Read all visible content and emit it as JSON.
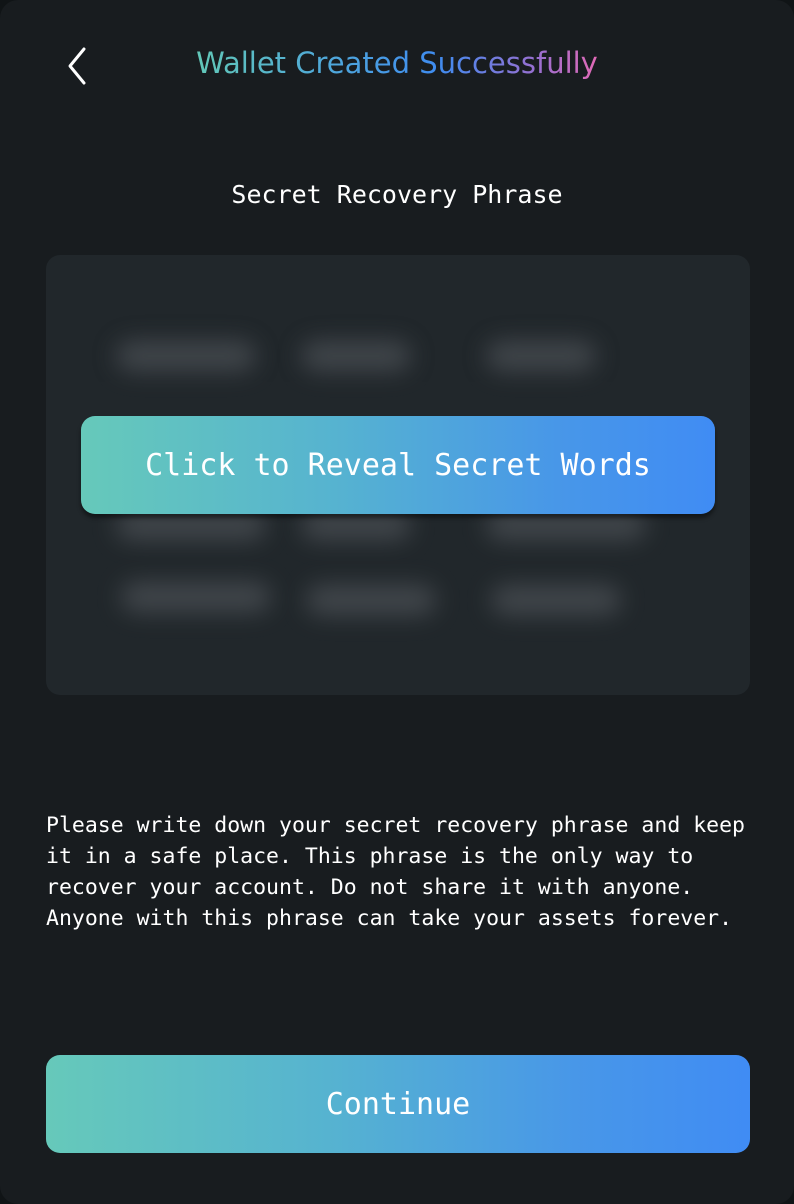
{
  "header": {
    "title": "Wallet Created Successfully",
    "back_icon": "chevron-left-icon"
  },
  "section_title": "Secret Recovery Phrase",
  "phrase_card": {
    "reveal_label": "Click to Reveal Secret Words",
    "hidden": true
  },
  "notice": "Please write down your secret recovery phrase and keep it in a safe place. This phrase is the only way to recover your account. Do not share it with anyone. Anyone with this phrase can take your assets forever.",
  "continue_label": "Continue",
  "colors": {
    "background": "#181c1f",
    "card": "#21272b",
    "gradient_start": "#66c9ba",
    "gradient_end": "#408cf4",
    "title_end": "#e26ab6"
  }
}
